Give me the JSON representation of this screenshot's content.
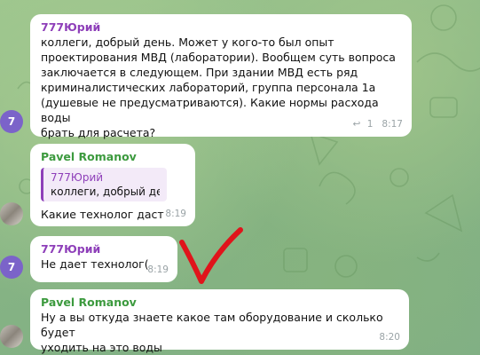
{
  "messages": [
    {
      "sender": "777Юрий",
      "text": "коллеги, добрый день. Может у кого-то был опыт\nпроектирования МВД (лаборатории). Вообщем суть вопроса\nзаключается в следующем. При здании МВД есть ряд\nкриминалистических лабораторий, группа персонала 1а\n(душевые не предусматриваются). Какие нормы расхода воды\nбрать для расчета?",
      "reply_count": "1",
      "time": "8:17",
      "avatar_label": "7",
      "avatar_color": "#7b63c9"
    },
    {
      "sender": "Pavel Romanov",
      "quote_sender": "777Юрий",
      "quote_text": "коллеги, добрый день...",
      "text": "Какие технолог даст",
      "time": "8:19"
    },
    {
      "sender": "777Юрий",
      "text": "Не дает технолог(",
      "time": "8:19",
      "avatar_label": "7",
      "avatar_color": "#7b63c9"
    },
    {
      "sender": "Pavel Romanov",
      "text": "Ну а вы откуда знаете какое там оборудование и сколько будет\nуходить на это воды",
      "time": "8:20"
    }
  ],
  "colors": {
    "sender_purple": "#8e3fb9",
    "sender_green": "#3c9a3e",
    "annotation_red": "#e0141b",
    "chat_background": "#8fb88a"
  },
  "icons": {
    "reply": "reply-arrow-icon",
    "checkmark_annotation": "red-checkmark-icon"
  }
}
